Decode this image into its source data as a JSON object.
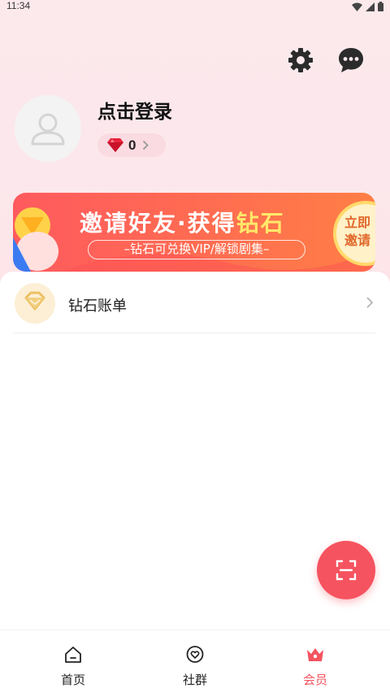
{
  "status_bar": {
    "time": "11:34"
  },
  "header": {
    "icons": {
      "settings": "gear-icon",
      "messages": "chat-bubble-icon"
    }
  },
  "profile": {
    "login_text": "点击登录",
    "diamond_count": "0"
  },
  "banner": {
    "title_prefix": "邀请好友·获得",
    "title_highlight": "钻石",
    "subtitle": "–钻石可兑换VIP/解锁剧集–",
    "invite_line1": "立即",
    "invite_line2": "邀请"
  },
  "menu": {
    "items": [
      {
        "label": "钻石账单",
        "icon": "diamond-bill-icon"
      }
    ]
  },
  "fab": {
    "icon": "scan-icon"
  },
  "bottom_nav": {
    "items": [
      {
        "label": "首页",
        "icon": "home-icon",
        "active": false
      },
      {
        "label": "社群",
        "icon": "community-icon",
        "active": false
      },
      {
        "label": "会员",
        "icon": "crown-icon",
        "active": true
      }
    ]
  },
  "colors": {
    "accent": "#f5535f",
    "banner_start": "#ff5a5e",
    "banner_end": "#ff7f45",
    "highlight": "#ffe86a",
    "top_background": "#fbe9ec"
  }
}
